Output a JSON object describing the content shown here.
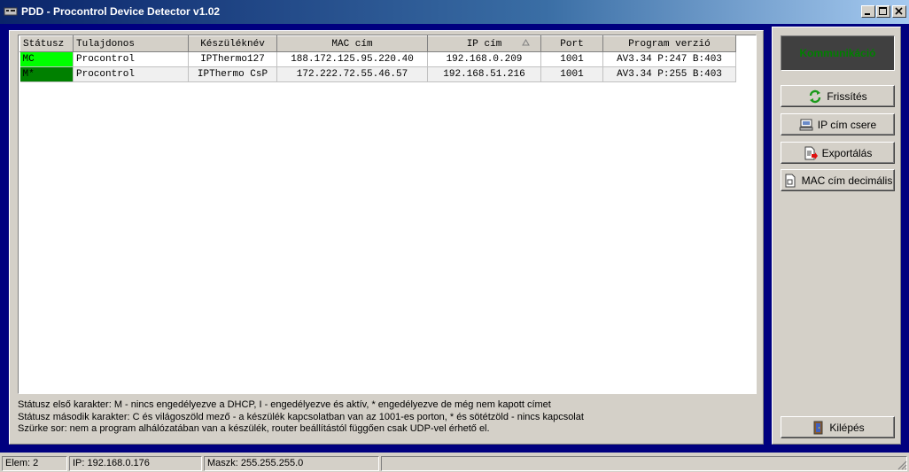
{
  "window": {
    "title": "PDD - Procontrol Device Detector v1.02"
  },
  "table": {
    "columns": [
      "Státusz",
      "Tulajdonos",
      "Készüléknév",
      "MAC cím",
      "IP cím",
      "Port",
      "Program verzió"
    ],
    "rows": [
      {
        "status": "MC",
        "status_color": "#00ff00",
        "owner": "Procontrol",
        "name": "IPThermo127",
        "mac": "188.172.125.95.220.40",
        "ip": "192.168.0.209",
        "port": "1001",
        "program": "AV3.34 P:247 B:403"
      },
      {
        "status": "M*",
        "status_color": "#008000",
        "owner": "Procontrol",
        "name": "IPThermo CsP",
        "mac": "172.222.72.55.46.57",
        "ip": "192.168.51.216",
        "port": "1001",
        "program": "AV3.34 P:255 B:403"
      }
    ]
  },
  "notes": [
    "Státusz első karakter:  M - nincs engedélyezve a DHCP, I - engedélyezve és aktív, * engedélyezve de még nem kapott címet",
    "Státusz második karakter:  C és világoszöld mező -  a készülék kapcsolatban van az 1001-es porton, * és sötétzöld - nincs kapcsolat",
    "Szürke sor: nem a program alhálózatában van a készülék, router beállítástól függően csak UDP-vel érhető el."
  ],
  "sidebar": {
    "comm_label": "Kommunikáció",
    "refresh_label": "Frissítés",
    "ipchange_label": "IP cím csere",
    "export_label": "Exportálás",
    "macdec_label": "MAC cím decimális",
    "exit_label": "Kilépés"
  },
  "statusbar": {
    "elem": "Elem: 2",
    "ip": "IP: 192.168.0.176",
    "mask": "Maszk: 255.255.255.0",
    "extra": ""
  },
  "icons": {
    "refresh": "refresh-icon",
    "ipchange": "computer-icon",
    "export": "export-icon",
    "macdec": "document-icon",
    "exit": "exit-door-icon"
  }
}
